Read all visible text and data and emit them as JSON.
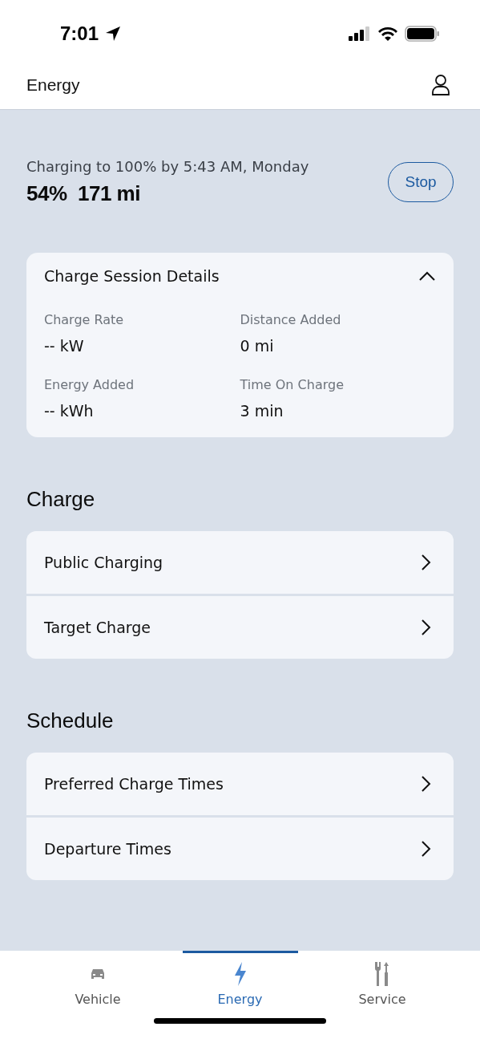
{
  "status_bar": {
    "time": "7:01"
  },
  "header": {
    "title": "Energy"
  },
  "charging": {
    "status": "Charging to 100% by 5:43 AM, Monday",
    "percent": "54%",
    "range": "171 mi",
    "button": "Stop"
  },
  "session": {
    "title": "Charge Session Details",
    "expanded": true,
    "stats": [
      {
        "label": "Charge Rate",
        "value": "-- kW"
      },
      {
        "label": "Distance Added",
        "value": "0 mi"
      },
      {
        "label": "Energy Added",
        "value": "-- kWh"
      },
      {
        "label": "Time On Charge",
        "value": "3 min"
      }
    ]
  },
  "sections": [
    {
      "title": "Charge",
      "items": [
        "Public Charging",
        "Target Charge"
      ]
    },
    {
      "title": "Schedule",
      "items": [
        "Preferred Charge Times",
        "Departure Times"
      ]
    }
  ],
  "tabs": [
    {
      "label": "Vehicle",
      "kind": "car",
      "selected": false
    },
    {
      "label": "Energy",
      "kind": "bolt",
      "selected": true
    },
    {
      "label": "Service",
      "kind": "tools",
      "selected": false
    }
  ]
}
